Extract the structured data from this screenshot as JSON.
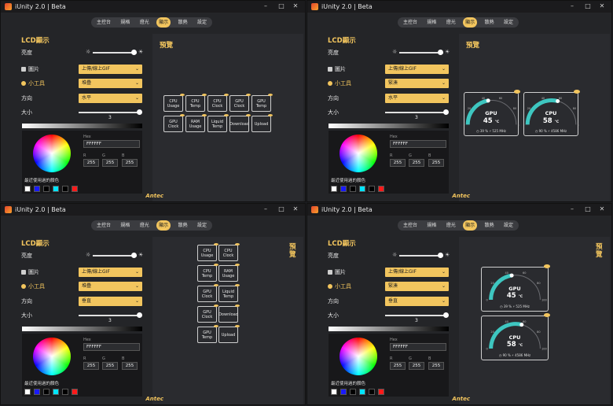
{
  "app": {
    "title": "iUnity 2.0 | Beta",
    "window_controls": {
      "minimize": "–",
      "maximize": "□",
      "close": "✕"
    }
  },
  "nav": {
    "tabs": [
      "主控台",
      "規格",
      "燈光",
      "顯示",
      "散熱",
      "設定"
    ],
    "active_index": 3
  },
  "settings": {
    "section_title": "LCD顯示",
    "brightness_label": "亮度",
    "image_label": "圖片",
    "image_value": "上傳/線上GIF",
    "widget_label": "小工具",
    "direction_label": "方向",
    "size_label": "大小",
    "size_value": "3",
    "brightness_level": 0.93,
    "size_level": 1.0
  },
  "color": {
    "hex_label": "Hex",
    "hex_value": "FFFFFF",
    "r_label": "R",
    "g_label": "G",
    "b_label": "B",
    "r": "255",
    "g": "255",
    "b": "255",
    "recent_label": "最近使用過的顏色",
    "recent_colors": [
      "#ffffff",
      "#1a1aff",
      "#000000",
      "#00e5ff",
      "#000000",
      "#ff1a1a"
    ]
  },
  "preview": {
    "title": "預覽",
    "brand": "Antec"
  },
  "panels": [
    {
      "widget_value": "堆疊",
      "direction_value": "水平",
      "preview_type": "tiles"
    },
    {
      "widget_value": "緊湊",
      "direction_value": "水平",
      "preview_type": "gauges"
    },
    {
      "widget_value": "堆疊",
      "direction_value": "垂直",
      "preview_type": "tiles"
    },
    {
      "widget_value": "緊湊",
      "direction_value": "垂直",
      "preview_type": "gauges"
    }
  ],
  "tiles": [
    "CPU Usage",
    "CPU Temp",
    "CPU Clock",
    "GPU Clock",
    "GPU Temp",
    "GPU Clock",
    "RAM Usage",
    "Liquid Temp",
    "Download",
    "Upload"
  ],
  "gauges": [
    {
      "name": "GPU",
      "temp": "45",
      "unit": "°C",
      "usage": "39 %",
      "clock": "525 MHz",
      "level": 0.45
    },
    {
      "name": "CPU",
      "temp": "58",
      "unit": "°C",
      "usage": "90 %",
      "clock": "4586 MHz",
      "level": 0.58
    }
  ],
  "gauge_ticks": [
    "0",
    "20",
    "40",
    "60",
    "80",
    "100"
  ],
  "colors": {
    "accent": "#f2c55e",
    "gauge_arc": "#3ec6c0"
  }
}
